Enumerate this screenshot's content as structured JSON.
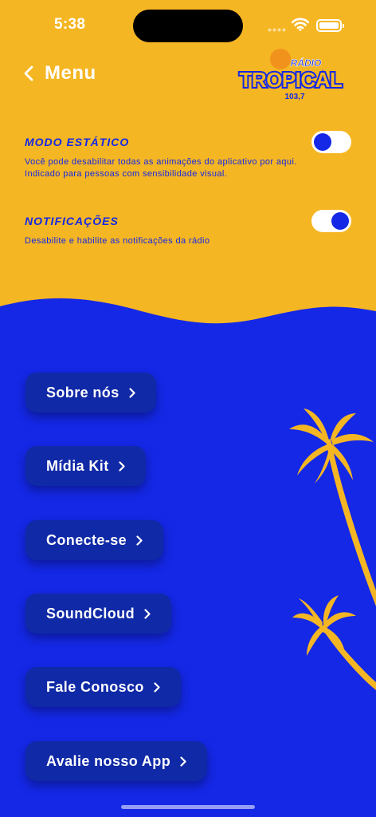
{
  "status_bar": {
    "time": "5:38"
  },
  "header": {
    "back_label": "Menu"
  },
  "logo": {
    "line1": "RÁDIO",
    "line2": "TROPICAL",
    "line3": "103,7"
  },
  "settings": [
    {
      "title": "MODO ESTÁTICO",
      "description": "Você pode desabilitar todas as animações do aplicativo por aqui. Indicado para pessoas com sensibilidade visual.",
      "enabled": false
    },
    {
      "title": "NOTIFICAÇÕES",
      "description": "Desabilite e habilite as notificações da rádio",
      "enabled": true
    }
  ],
  "menu": [
    {
      "label": "Sobre nós"
    },
    {
      "label": "Mídia Kit"
    },
    {
      "label": "Conecte-se"
    },
    {
      "label": "SoundCloud"
    },
    {
      "label": "Fale Conosco"
    },
    {
      "label": "Avalie nosso App"
    }
  ],
  "colors": {
    "yellow": "#F5B623",
    "blue": "#1428E6",
    "button": "#1029A6"
  }
}
